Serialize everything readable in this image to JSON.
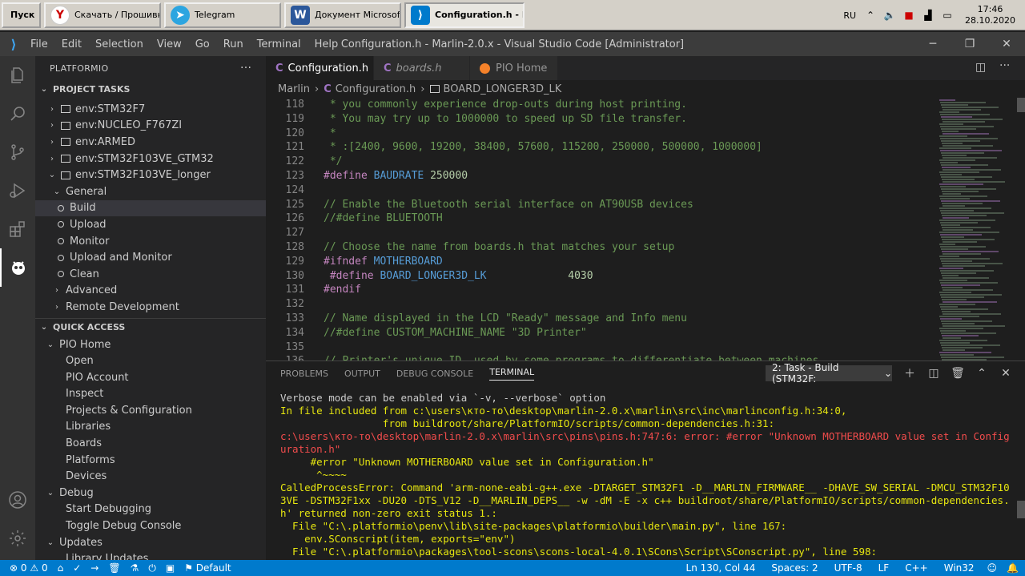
{
  "taskbar": {
    "start": "Пуск",
    "items": [
      {
        "label": "Скачать / Прошивка...",
        "icon": "yandex-icon",
        "color": "#cc0000"
      },
      {
        "label": "Telegram",
        "icon": "telegram-icon",
        "color": "#2ca5e0"
      },
      {
        "label": "Документ Microsoft ...",
        "icon": "word-icon",
        "color": "#2b579a"
      },
      {
        "label": "Configuration.h - M...",
        "icon": "vscode-icon",
        "color": "#007acc"
      }
    ],
    "lang": "RU",
    "time": "17:46",
    "date": "28.10.2020"
  },
  "titlebar": {
    "menu": [
      "File",
      "Edit",
      "Selection",
      "View",
      "Go",
      "Run",
      "Terminal",
      "Help"
    ],
    "title": "Configuration.h - Marlin-2.0.x - Visual Studio Code [Administrator]"
  },
  "sidebar": {
    "header": "PLATFORMIO",
    "project_tasks": "PROJECT TASKS",
    "envs": [
      "env:STM32F7",
      "env:NUCLEO_F767ZI",
      "env:ARMED",
      "env:STM32F103VE_GTM32",
      "env:STM32F103VE_longer"
    ],
    "general": "General",
    "tasks": [
      "Build",
      "Upload",
      "Monitor",
      "Upload and Monitor",
      "Clean"
    ],
    "advanced": "Advanced",
    "remote": "Remote Development",
    "quick_access": "QUICK ACCESS",
    "pio_home": "PIO Home",
    "pio_items": [
      "Open",
      "PIO Account",
      "Inspect",
      "Projects & Configuration",
      "Libraries",
      "Boards",
      "Platforms",
      "Devices"
    ],
    "debug": "Debug",
    "debug_items": [
      "Start Debugging",
      "Toggle Debug Console"
    ],
    "updates": "Updates",
    "update_items": [
      "Library Updates"
    ]
  },
  "tabs": [
    {
      "label": "Configuration.h",
      "icon": "C"
    },
    {
      "label": "boards.h",
      "icon": "C"
    },
    {
      "label": "PIO Home",
      "icon": "pio"
    }
  ],
  "breadcrumb": {
    "root": "Marlin",
    "file": "Configuration.h",
    "symbol": "BOARD_LONGER3D_LK"
  },
  "code": [
    {
      "n": "118",
      "parts": [
        [
          "cm",
          " * you commonly experience drop-outs during host printing."
        ]
      ]
    },
    {
      "n": "119",
      "parts": [
        [
          "cm",
          " * You may try up to 1000000 to speed up SD file transfer."
        ]
      ]
    },
    {
      "n": "120",
      "parts": [
        [
          "cm",
          " *"
        ]
      ]
    },
    {
      "n": "121",
      "parts": [
        [
          "cm",
          " * :[2400, 9600, 19200, 38400, 57600, 115200, 250000, 500000, 1000000]"
        ]
      ]
    },
    {
      "n": "122",
      "parts": [
        [
          "cm",
          " */"
        ]
      ]
    },
    {
      "n": "123",
      "parts": [
        [
          "kw",
          "#define "
        ],
        [
          "mac",
          "BAUDRATE "
        ],
        [
          "num",
          "250000"
        ]
      ]
    },
    {
      "n": "124",
      "parts": []
    },
    {
      "n": "125",
      "parts": [
        [
          "cm",
          "// Enable the Bluetooth serial interface on AT90USB devices"
        ]
      ]
    },
    {
      "n": "126",
      "parts": [
        [
          "cm",
          "//#define BLUETOOTH"
        ]
      ]
    },
    {
      "n": "127",
      "parts": []
    },
    {
      "n": "128",
      "parts": [
        [
          "cm",
          "// Choose the name from boards.h that matches your setup"
        ]
      ]
    },
    {
      "n": "129",
      "parts": [
        [
          "kw",
          "#ifndef "
        ],
        [
          "mac",
          "MOTHERBOARD"
        ]
      ]
    },
    {
      "n": "130",
      "parts": [
        [
          "kw",
          " #define "
        ],
        [
          "mac",
          "BOARD_LONGER3D_LK"
        ],
        [
          "num",
          "             4030"
        ]
      ]
    },
    {
      "n": "131",
      "parts": [
        [
          "kw",
          "#endif"
        ]
      ]
    },
    {
      "n": "132",
      "parts": []
    },
    {
      "n": "133",
      "parts": [
        [
          "cm",
          "// Name displayed in the LCD \"Ready\" message and Info menu"
        ]
      ]
    },
    {
      "n": "134",
      "parts": [
        [
          "cm",
          "//#define CUSTOM_MACHINE_NAME \"3D Printer\""
        ]
      ]
    },
    {
      "n": "135",
      "parts": []
    },
    {
      "n": "136",
      "parts": [
        [
          "cm",
          "// Printer's unique ID, used by some programs to differentiate between machines."
        ]
      ]
    }
  ],
  "panel": {
    "tabs": [
      "PROBLEMS",
      "OUTPUT",
      "DEBUG CONSOLE",
      "TERMINAL"
    ],
    "terminal_select": "2: Task - Build (STM32F:",
    "lines": [
      {
        "c": "w",
        "t": "Verbose mode can be enabled via `-v, --verbose` option"
      },
      {
        "c": "y",
        "t": "In file included from c:\\users\\кто-то\\desktop\\marlin-2.0.x\\marlin\\src\\inc\\marlinconfig.h:34:0,"
      },
      {
        "c": "y",
        "t": "                 from buildroot/share/PlatformIO/scripts/common-dependencies.h:31:"
      },
      {
        "c": "r",
        "t": "c:\\users\\кто-то\\desktop\\marlin-2.0.x\\marlin\\src\\pins\\pins.h:747:6: error: #error \"Unknown MOTHERBOARD value set in Config"
      },
      {
        "c": "r",
        "t": "uration.h\""
      },
      {
        "c": "y",
        "t": "     #error \"Unknown MOTHERBOARD value set in Configuration.h\""
      },
      {
        "c": "y",
        "t": "      ^~~~~"
      },
      {
        "c": "y",
        "t": "CalledProcessError: Command 'arm-none-eabi-g++.exe -DTARGET_STM32F1 -D__MARLIN_FIRMWARE__ -DHAVE_SW_SERIAL -DMCU_STM32F10"
      },
      {
        "c": "y",
        "t": "3VE -DSTM32F1xx -DU20 -DTS_V12 -D__MARLIN_DEPS__ -w -dM -E -x c++ buildroot/share/PlatformIO/scripts/common-dependencies."
      },
      {
        "c": "y",
        "t": "h' returned non-zero exit status 1.:"
      },
      {
        "c": "y",
        "t": "  File \"C:\\.platformio\\penv\\lib\\site-packages\\platformio\\builder\\main.py\", line 167:"
      },
      {
        "c": "y",
        "t": "    env.SConscript(item, exports=\"env\")"
      },
      {
        "c": "y",
        "t": "  File \"C:\\.platformio\\packages\\tool-scons\\scons-local-4.0.1\\SCons\\Script\\SConscript.py\", line 598:"
      }
    ]
  },
  "status": {
    "errors": "0",
    "warnings": "0",
    "env": "Default",
    "position": "Ln 130, Col 44",
    "spaces": "Spaces: 2",
    "encoding": "UTF-8",
    "eol": "LF",
    "lang": "C++",
    "platform": "Win32"
  }
}
